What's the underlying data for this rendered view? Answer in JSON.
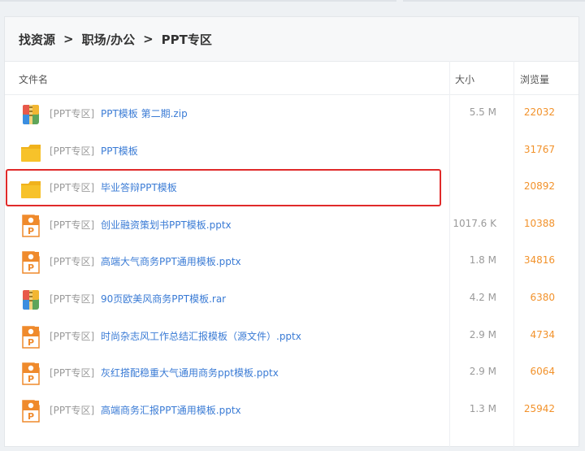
{
  "breadcrumb": {
    "root": "找资源",
    "sep1": ">",
    "level1": "职场/办公",
    "sep2": ">",
    "level2": "PPT专区"
  },
  "columns": {
    "name": "文件名",
    "size": "大小",
    "views": "浏览量"
  },
  "files": [
    {
      "tag": "[PPT专区]",
      "name": "PPT模板 第二期.zip",
      "size": "5.5 M",
      "views": "22032",
      "type": "archive-icon"
    },
    {
      "tag": "[PPT专区]",
      "name": "PPT模板",
      "size": "",
      "views": "31767",
      "type": "folder-icon"
    },
    {
      "tag": "[PPT专区]",
      "name": "毕业答辩PPT模板",
      "size": "",
      "views": "20892",
      "type": "folder-icon",
      "highlighted": true
    },
    {
      "tag": "[PPT专区]",
      "name": "创业融资策划书PPT模板.pptx",
      "size": "1017.6 K",
      "views": "10388",
      "type": "pptx-icon"
    },
    {
      "tag": "[PPT专区]",
      "name": "高端大气商务PPT通用模板.pptx",
      "size": "1.8 M",
      "views": "34816",
      "type": "pptx-icon"
    },
    {
      "tag": "[PPT专区]",
      "name": "90页欧美风商务PPT模板.rar",
      "size": "4.2 M",
      "views": "6380",
      "type": "archive-icon"
    },
    {
      "tag": "[PPT专区]",
      "name": "时尚杂志风工作总结汇报模板（源文件）.pptx",
      "size": "2.9 M",
      "views": "4734",
      "type": "pptx-icon"
    },
    {
      "tag": "[PPT专区]",
      "name": "灰红搭配稳重大气通用商务ppt模板.pptx",
      "size": "2.9 M",
      "views": "6064",
      "type": "pptx-icon"
    },
    {
      "tag": "[PPT专区]",
      "name": "高端商务汇报PPT通用模板.pptx",
      "size": "1.3 M",
      "views": "25942",
      "type": "pptx-icon"
    }
  ],
  "colors": {
    "link": "#3a7bd5",
    "views": "#f2922b",
    "highlight": "#e02a2a",
    "folder": "#f7c22a",
    "pptx": "#ef8a2c"
  }
}
